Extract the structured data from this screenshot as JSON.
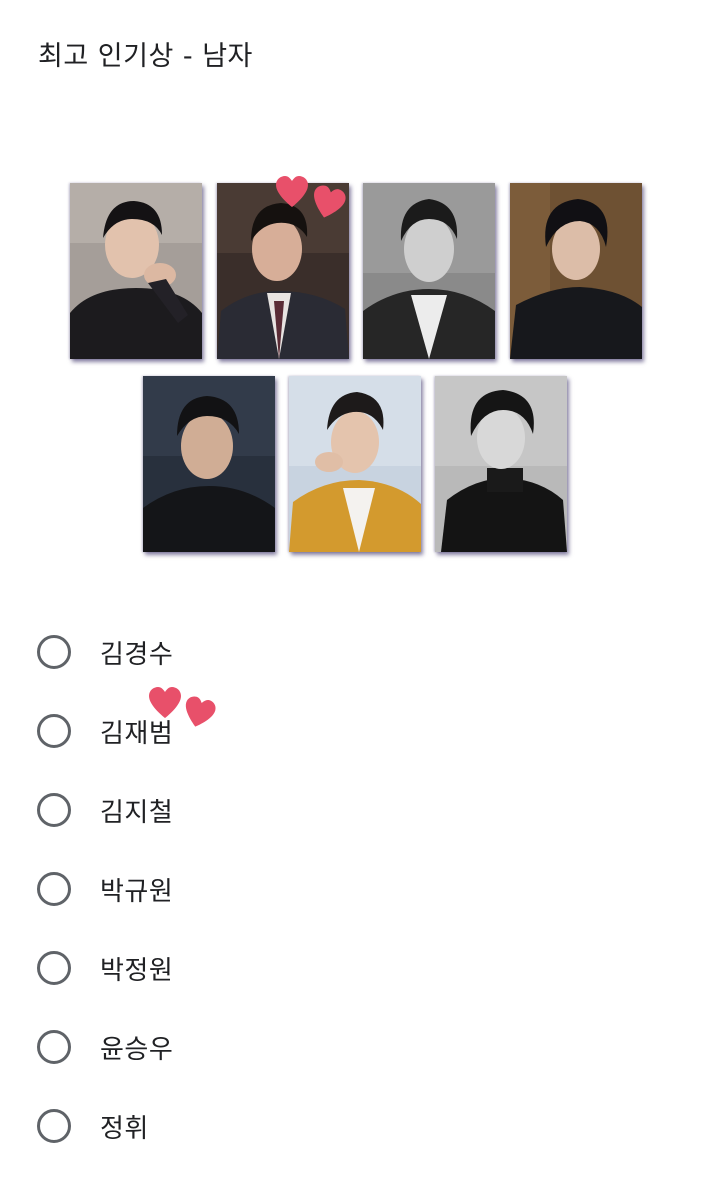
{
  "form": {
    "question_title": "최고 인기상 - 남자"
  },
  "options": [
    {
      "label": "김경수"
    },
    {
      "label": "김재범"
    },
    {
      "label": "김지철"
    },
    {
      "label": "박규원"
    },
    {
      "label": "박정원"
    },
    {
      "label": "윤승우"
    },
    {
      "label": "정휘"
    }
  ],
  "decorations": {
    "heart_color": "#e8506a",
    "icon": "heart-icon"
  },
  "colors": {
    "radio_border": "#5f6368",
    "text": "#202124",
    "photo_shadow": "#28205a"
  }
}
